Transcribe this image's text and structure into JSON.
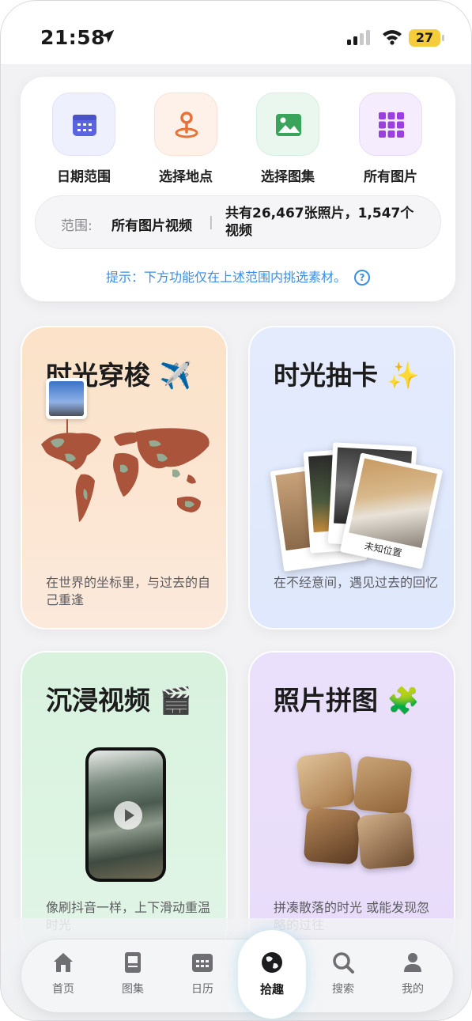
{
  "status_bar": {
    "time": "21:58",
    "battery": "27",
    "battery_color": "#f5cc3a"
  },
  "quick_actions": [
    {
      "label": "日期范围",
      "icon": "calendar-icon",
      "color": "#5b64e0"
    },
    {
      "label": "选择地点",
      "icon": "location-pin-icon",
      "color": "#e8733a"
    },
    {
      "label": "选择图集",
      "icon": "image-icon",
      "color": "#3aa35c"
    },
    {
      "label": "所有图片",
      "icon": "grid-icon",
      "color": "#9b3fe0"
    }
  ],
  "range": {
    "label": "范围:",
    "value": "所有图片视频",
    "separator": "|",
    "count": "共有26,467张照片，1,547个视频"
  },
  "hint": {
    "text": "提示：下方功能仅在上述范围内挑选素材。",
    "help": "?",
    "color": "#3a8ee6"
  },
  "features": [
    {
      "title": "时光穿梭 ✈️",
      "desc": "在世界的坐标里，与过去的自己重逢"
    },
    {
      "title": "时光抽卡 ✨",
      "desc": "在不经意间，遇见过去的回忆",
      "captions": [
        "未知位",
        "未知位置"
      ]
    },
    {
      "title": "沉浸视频 🎬",
      "desc": "像刷抖音一样，上下滑动重温时光"
    },
    {
      "title": "照片拼图 🧩",
      "desc": "拼凑散落的时光 或能发现忽略的过往"
    }
  ],
  "tabbar": [
    {
      "label": "首页",
      "icon": "home-icon"
    },
    {
      "label": "图集",
      "icon": "album-icon"
    },
    {
      "label": "日历",
      "icon": "calendar-icon"
    },
    {
      "label": "拾趣",
      "icon": "globe-icon",
      "active": true
    },
    {
      "label": "搜索",
      "icon": "search-icon"
    },
    {
      "label": "我的",
      "icon": "person-icon"
    }
  ]
}
